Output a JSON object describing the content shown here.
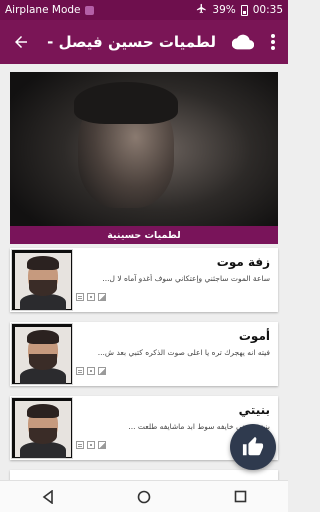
{
  "status_bar": {
    "left_text": "Airplane Mode",
    "battery": "39%",
    "time": "00:35",
    "icons": [
      "airplane-icon",
      "battery-icon"
    ]
  },
  "app_bar": {
    "title": "لطميات حسين فيصل - ا...",
    "icons": [
      "back-arrow-icon",
      "cloud-icon",
      "more-vert-icon"
    ]
  },
  "banner": {
    "caption": "لطميات حسينية"
  },
  "items": [
    {
      "title": "زفة موت",
      "subtitle": "ساعة الموت ساجثني وإعتكاني  سوف أغدو آماه لا ل..."
    },
    {
      "title": "أموت",
      "subtitle": "فيته انه يهجرك تره  يا اعلى صوت الذكره  كتبي بعد ش..."
    },
    {
      "title": "بنيتي",
      "subtitle": "بنيتي بعيني خايفه  سوط ابد ماشايفه  طلعت ..."
    }
  ],
  "colors": {
    "status_bar": "#6e0f4d",
    "app_bar": "#7a1556",
    "caption": "#79145a",
    "fab": "#2f3a4e"
  },
  "fab": {
    "icon": "thumbs-up-icon"
  },
  "nav": {
    "icons": [
      "back-triangle-icon",
      "home-circle-icon",
      "recents-square-icon"
    ]
  }
}
